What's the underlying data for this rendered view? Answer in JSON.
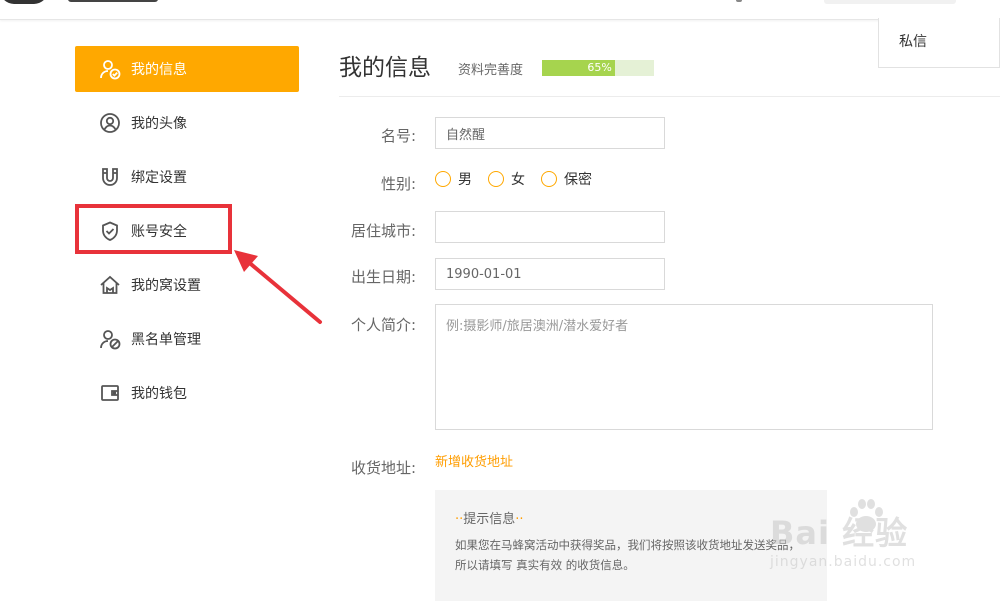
{
  "header": {
    "private_message": "私信"
  },
  "sidebar": {
    "items": [
      {
        "label": "我的信息",
        "icon": "user-check-icon",
        "active": true
      },
      {
        "label": "我的头像",
        "icon": "avatar-icon"
      },
      {
        "label": "绑定设置",
        "icon": "magnet-icon"
      },
      {
        "label": "账号安全",
        "icon": "shield-icon"
      },
      {
        "label": "我的窝设置",
        "icon": "home-icon"
      },
      {
        "label": "黑名单管理",
        "icon": "user-block-icon"
      },
      {
        "label": "我的钱包",
        "icon": "wallet-icon"
      }
    ]
  },
  "main": {
    "title": "我的信息",
    "completeness_label": "资料完善度",
    "completeness_value": 0.65,
    "completeness_text": "65%",
    "form": {
      "name_label": "名号:",
      "name_value": "自然醒",
      "gender_label": "性别:",
      "gender_options": [
        "男",
        "女",
        "保密"
      ],
      "city_label": "居住城市:",
      "city_value": "",
      "birth_label": "出生日期:",
      "birth_value": "1990-01-01",
      "bio_label": "个人简介:",
      "bio_placeholder": "例:摄影师/旅居澳洲/潜水爱好者",
      "address_label": "收货地址:",
      "add_address": "新增收货地址"
    },
    "tip": {
      "title": "提示信息",
      "body": "如果您在马蜂窝活动中获得奖品，我们将按照该收货地址发送奖品， 所以请填写 真实有效 的收货信息。"
    }
  },
  "watermark": {
    "main": "Bai 经验",
    "sub": "jingyan.baidu.com"
  },
  "colors": {
    "accent": "#ffa800",
    "progress": "#a6d44e",
    "highlight": "#e8323a",
    "link": "#ff9d00"
  }
}
